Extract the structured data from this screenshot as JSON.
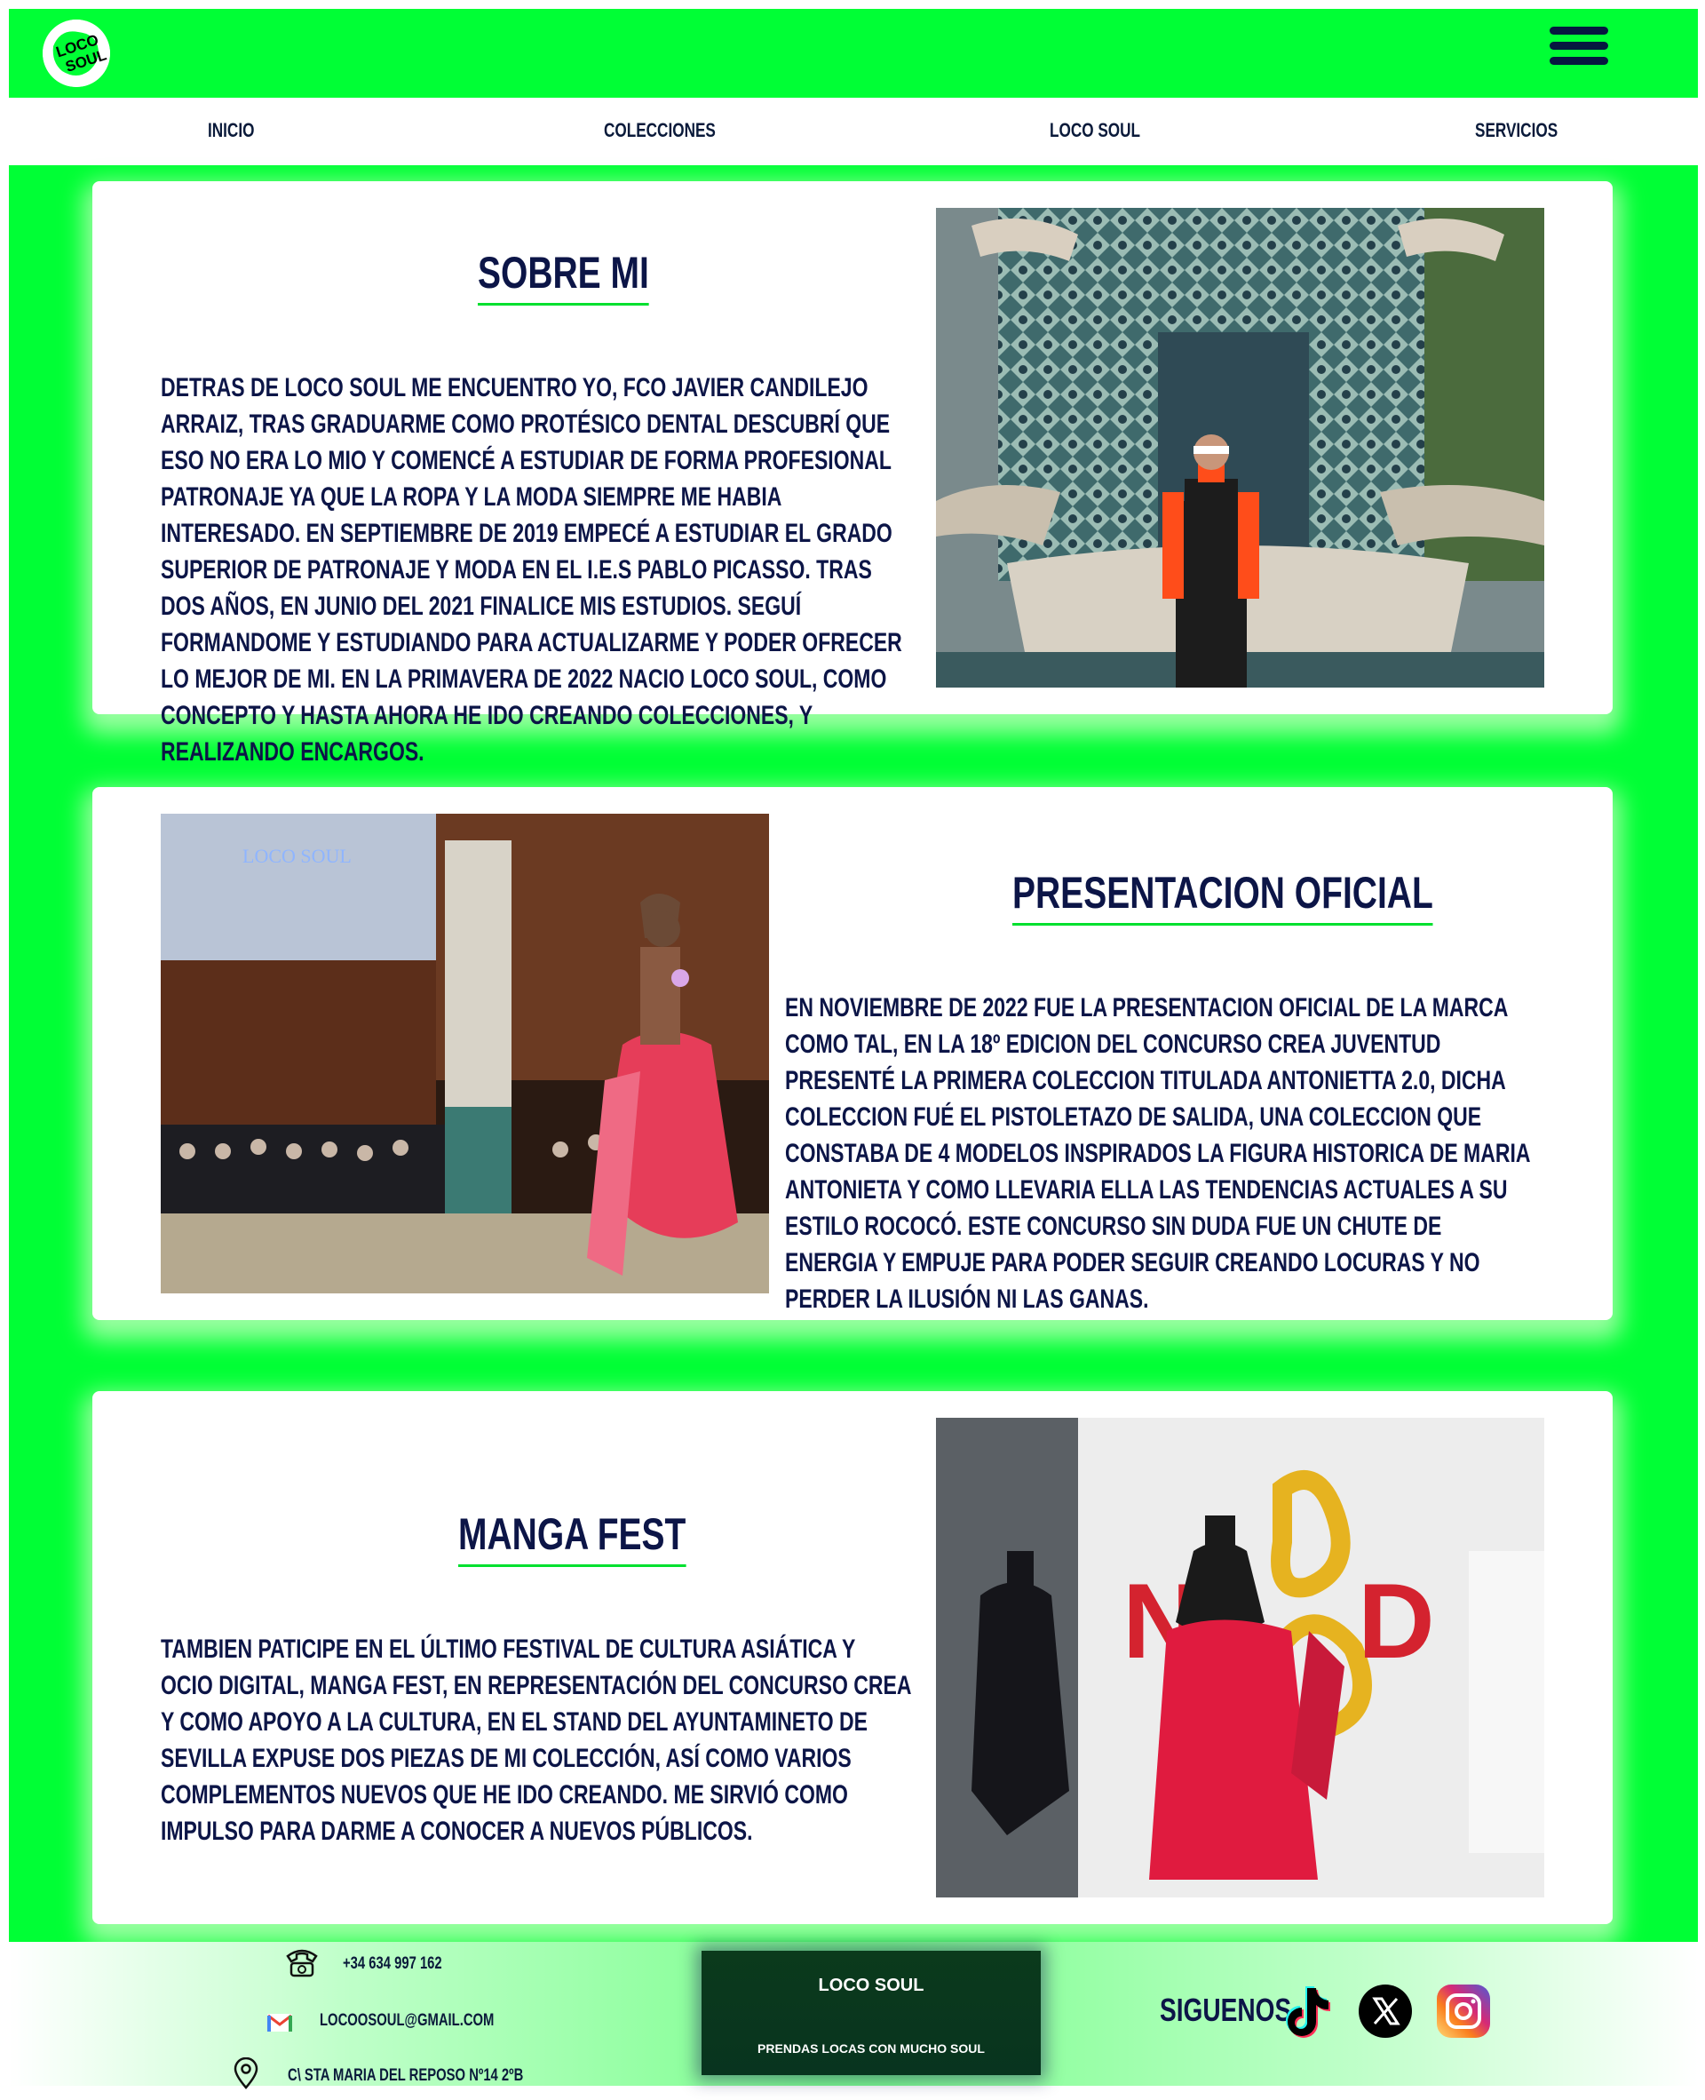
{
  "header": {
    "logo_text": "LOCO SOUL",
    "menu_icon": "hamburger-menu-icon",
    "bg_color": "#00ff35"
  },
  "nav": {
    "items": [
      "INICIO",
      "COLECCIONES",
      "LOCO SOUL",
      "SERVICIOS"
    ]
  },
  "sections": [
    {
      "title": "SOBRE MI",
      "text": "DETRAS DE LOCO SOUL ME ENCUENTRO YO, FCO JAVIER CANDILEJO ARRAIZ, TRAS GRADUARME COMO PROTÉSICO DENTAL DESCUBRÍ QUE ESO NO ERA LO MIO Y COMENCÉ A ESTUDIAR DE FORMA PROFESIONAL PATRONAJE YA QUE LA ROPA Y LA MODA SIEMPRE ME HABIA INTERESADO. EN SEPTIEMBRE DE 2019 EMPECÉ A ESTUDIAR EL GRADO SUPERIOR DE PATRONAJE Y MODA EN EL I.E.S PABLO PICASSO. TRAS DOS AÑOS, EN JUNIO DEL 2021 FINALICE MIS ESTUDIOS. SEGUÍ FORMANDOME Y ESTUDIANDO PARA ACTUALIZARME Y PODER OFRECER LO MEJOR DE MI. EN LA PRIMAVERA DE 2022 NACIO LOCO SOUL, COMO CONCEPTO Y HASTA AHORA HE IDO CREANDO COLECCIONES, Y REALIZANDO ENCARGOS."
    },
    {
      "title": "PRESENTACION OFICIAL",
      "photo_caption": "LOCO SOUL",
      "text": "EN NOVIEMBRE DE 2022 FUE LA PRESENTACION OFICIAL DE LA MARCA COMO TAL, EN LA 18º EDICION DEL CONCURSO CREA JUVENTUD PRESENTÉ LA PRIMERA COLECCION TITULADA ANTONIETTA 2.0, DICHA COLECCION FUÉ EL PISTOLETAZO DE SALIDA, UNA COLECCION QUE CONSTABA DE 4 MODELOS INSPIRADOS LA FIGURA HISTORICA DE MARIA ANTONIETA Y COMO LLEVARIA ELLA LAS TENDENCIAS ACTUALES A SU ESTILO ROCOCÓ. ESTE CONCURSO SIN DUDA FUE UN CHUTE DE ENERGIA Y EMPUJE PARA PODER SEGUIR CREANDO LOCURAS Y NO PERDER LA ILUSIÓN NI LAS GANAS."
    },
    {
      "title": "MANGA FEST",
      "text": "TAMBIEN PATICIPE EN EL ÚLTIMO FESTIVAL DE CULTURA ASIÁTICA Y OCIO DIGITAL, MANGA FEST, EN REPRESENTACIÓN DEL CONCURSO CREA Y COMO APOYO A LA CULTURA, EN EL STAND DEL AYUNTAMINETO DE SEVILLA EXPUSE DOS PIEZAS DE MI COLECCIÓN, ASÍ COMO VARIOS COMPLEMENTOS NUEVOS QUE HE IDO CREANDO. ME SIRVIÓ COMO IMPULSO PARA DARME A CONOCER A NUEVOS PÚBLICOS."
    }
  ],
  "footer": {
    "phone": "+34 634 997 162",
    "email": "LOCOOSOUL@GMAIL.COM",
    "address": "C\\ STA MARIA DEL REPOSO Nº14 2ºB",
    "brand_name": "LOCO SOUL",
    "slogan": "PRENDAS LOCAS CON MUCHO SOUL",
    "follow_label": "SIGUENOS",
    "social": [
      "tiktok-icon",
      "x-icon",
      "instagram-icon"
    ]
  },
  "colors": {
    "accent_green": "#00ff35",
    "text_navy": "#0c1547"
  }
}
